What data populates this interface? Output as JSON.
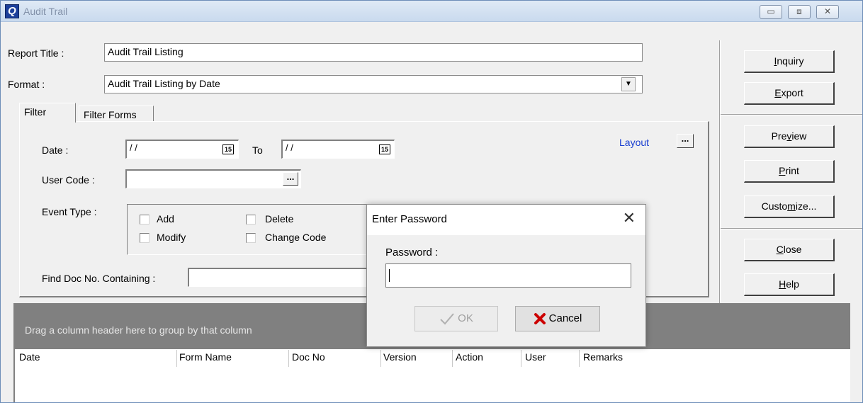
{
  "window": {
    "title": "Audit Trail",
    "app_icon": "Q",
    "minimize_glyph": "▭",
    "restore_glyph": "⧈",
    "close_glyph": "✕"
  },
  "form": {
    "report_title_label": "Report Title :",
    "report_title_value": "Audit Trail Listing",
    "format_label": "Format :",
    "format_value": "Audit Trail Listing by Date",
    "dropdown_glyph": "▼"
  },
  "tabs": [
    {
      "label": "Filter",
      "active": true
    },
    {
      "label": "Filter Forms",
      "active": false
    }
  ],
  "filter": {
    "date_label": "Date :",
    "date_from": "/ /",
    "date_to_label": "To",
    "date_to": "/ /",
    "calendar_glyph": "15",
    "layout_label": "Layout",
    "ellipsis": "...",
    "user_code_label": "User Code :",
    "user_code_value": "",
    "event_type_label": "Event Type :",
    "event_types": [
      "Add",
      "Delete",
      "Modify",
      "Change Code"
    ],
    "find_doc_label": "Find Doc No. Containing :",
    "find_doc_value": ""
  },
  "buttons": {
    "inquiry": {
      "pre": "",
      "u": "I",
      "post": "nquiry"
    },
    "export": {
      "pre": "",
      "u": "E",
      "post": "xport"
    },
    "preview": {
      "pre": "Pre",
      "u": "v",
      "post": "iew"
    },
    "print": {
      "pre": "",
      "u": "P",
      "post": "rint"
    },
    "customize": {
      "pre": "Custo",
      "u": "m",
      "post": "ize..."
    },
    "close": {
      "pre": "",
      "u": "C",
      "post": "lose"
    },
    "help": {
      "pre": "",
      "u": "H",
      "post": "elp"
    }
  },
  "grid": {
    "group_hint": "Drag a column header here to group by that column",
    "columns": [
      "Date",
      "Form Name",
      "Doc No",
      "Version",
      "Action",
      "User",
      "Remarks"
    ]
  },
  "dialog": {
    "title": "Enter Password",
    "close_glyph": "✕",
    "password_label": "Password :",
    "password_value": "",
    "ok_label": "OK",
    "ok_enabled": false,
    "cancel_label": "Cancel",
    "ok_icon": "check-icon",
    "cancel_icon": "x-icon",
    "cancel_icon_color": "#cc0000"
  }
}
